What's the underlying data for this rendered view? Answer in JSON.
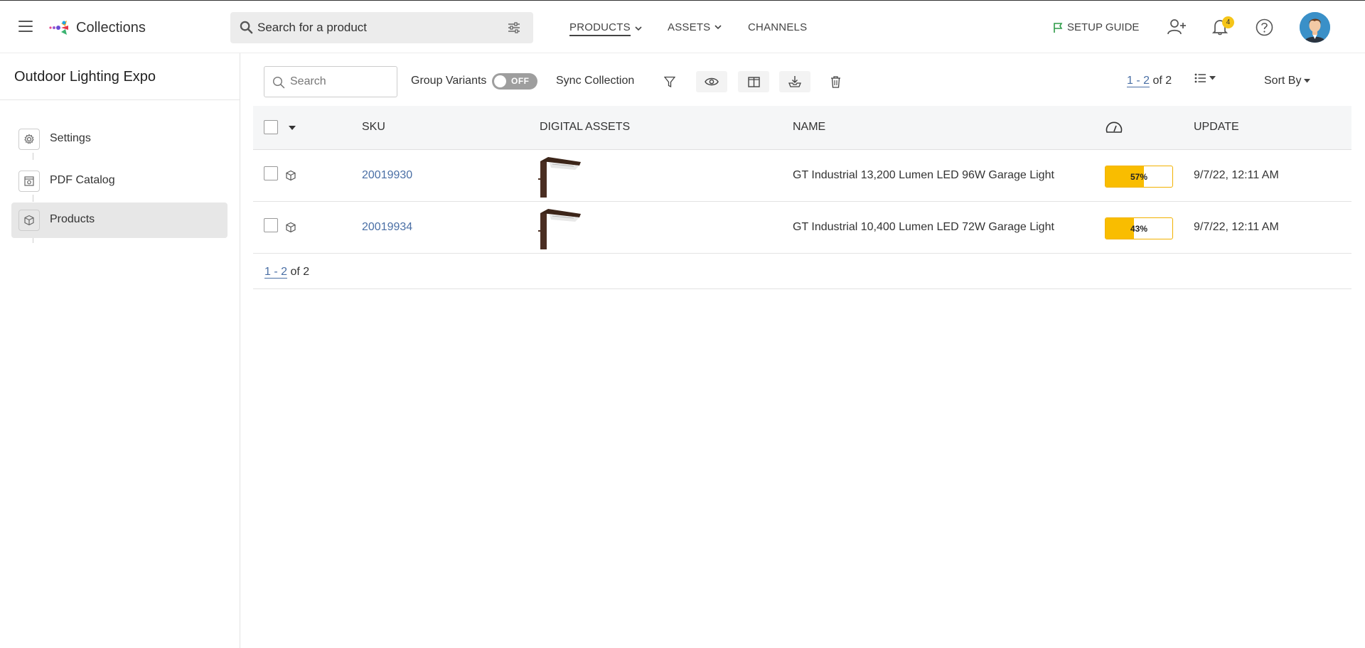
{
  "app": {
    "title": "Collections"
  },
  "header": {
    "search_placeholder": "Search for a product",
    "nav": [
      {
        "label": "PRODUCTS",
        "active": true,
        "has_dropdown": true
      },
      {
        "label": "ASSETS",
        "active": false,
        "has_dropdown": true
      },
      {
        "label": "CHANNELS",
        "active": false,
        "has_dropdown": false
      }
    ],
    "setup_guide": "SETUP GUIDE",
    "notification_count": "4"
  },
  "sidebar": {
    "collection_name": "Outdoor Lighting Expo",
    "items": [
      {
        "label": "Settings",
        "icon": "gear-icon",
        "active": false
      },
      {
        "label": "PDF Catalog",
        "icon": "catalog-icon",
        "active": false
      },
      {
        "label": "Products",
        "icon": "cube-icon",
        "active": true
      }
    ]
  },
  "toolbar": {
    "search_placeholder": "Search",
    "group_variants_label": "Group Variants",
    "group_variants_state": "OFF",
    "sync_label": "Sync Collection",
    "pager_range": "1 - 2",
    "pager_total": "of 2",
    "sort_label": "Sort By"
  },
  "table": {
    "columns": {
      "sku": "SKU",
      "assets": "DIGITAL ASSETS",
      "name": "NAME",
      "score_icon": "gauge-icon",
      "update": "UPDATE"
    },
    "rows": [
      {
        "sku": "20019930",
        "name": "GT Industrial 13,200 Lumen LED 96W Garage Light",
        "score": "57%",
        "score_value": 0.57,
        "update": "9/7/22, 12:11 AM"
      },
      {
        "sku": "20019934",
        "name": "GT Industrial 10,400 Lumen LED 72W Garage Light",
        "score": "43%",
        "score_value": 0.43,
        "update": "9/7/22, 12:11 AM"
      }
    ],
    "footer_range": "1 - 2",
    "footer_total": "of 2"
  },
  "colors": {
    "accent_link": "#4a6fa5",
    "score_fill": "#f9bd00",
    "badge": "#f5c518"
  }
}
